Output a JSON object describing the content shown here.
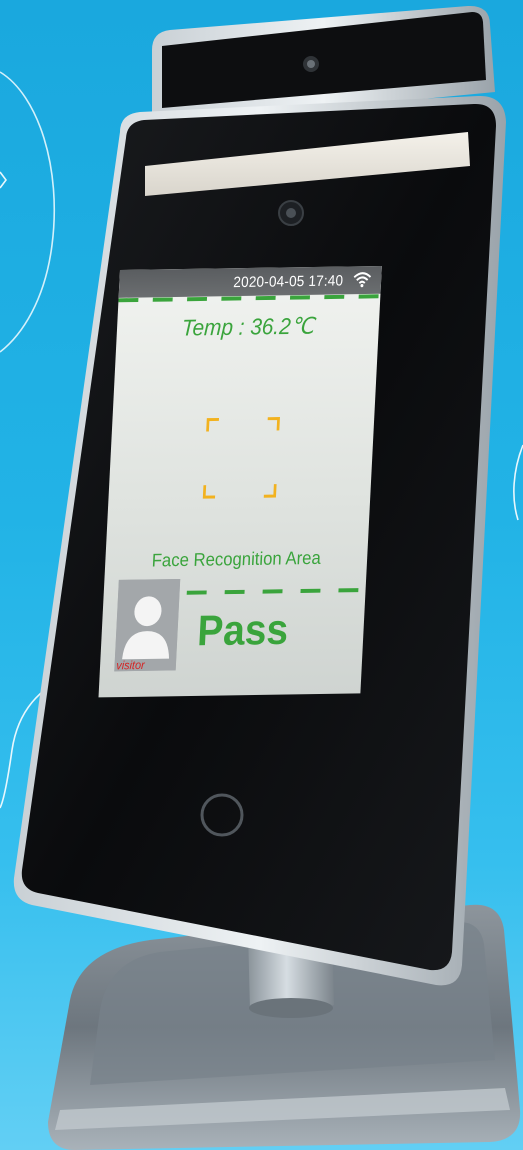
{
  "status_bar": {
    "datetime": "2020-04-05 17:40",
    "wifi_icon": "wifi-icon"
  },
  "screen": {
    "temperature": "Temp : 36.2℃",
    "face_frame_icon": "face-frame-icon",
    "area_label": "Face Recognition Area",
    "visitor_label": "visitor",
    "result": "Pass"
  },
  "colors": {
    "background": "#22b3e6",
    "screen_green": "#3aa43c",
    "face_frame": "#f2b21f",
    "visitor_red": "#d52424",
    "status_bar": "#5f6265"
  }
}
